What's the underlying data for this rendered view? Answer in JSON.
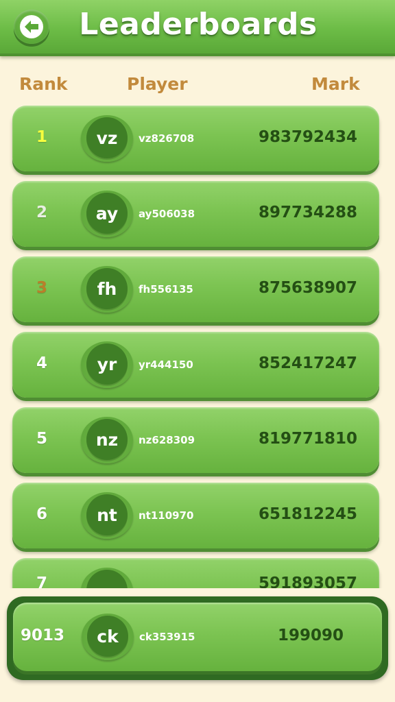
{
  "header": {
    "title": "Leaderboards",
    "back_icon": "back-arrow-icon"
  },
  "columns": {
    "rank": "Rank",
    "player": "Player",
    "mark": "Mark"
  },
  "colors": {
    "header_green": "#6cbc46",
    "row_green": "#7cc452",
    "background": "#fcf4dc",
    "column_header": "#c28a3c",
    "score_text": "#244f14",
    "rank_gold": "#f6ff3e",
    "rank_silver": "#e8efe2",
    "rank_bronze": "#b97f2a"
  },
  "rows": [
    {
      "rank": "1",
      "initials": "vz",
      "name": "vz826708",
      "mark": "983792434",
      "medal": "gold"
    },
    {
      "rank": "2",
      "initials": "ay",
      "name": "ay506038",
      "mark": "897734288",
      "medal": "silver"
    },
    {
      "rank": "3",
      "initials": "fh",
      "name": "fh556135",
      "mark": "875638907",
      "medal": "bronze"
    },
    {
      "rank": "4",
      "initials": "yr",
      "name": "yr444150",
      "mark": "852417247",
      "medal": ""
    },
    {
      "rank": "5",
      "initials": "nz",
      "name": "nz628309",
      "mark": "819771810",
      "medal": ""
    },
    {
      "rank": "6",
      "initials": "nt",
      "name": "nt110970",
      "mark": "651812245",
      "medal": ""
    },
    {
      "rank": "7",
      "initials": "",
      "name": "",
      "mark": "591893057",
      "medal": ""
    }
  ],
  "current_player": {
    "rank": "9013",
    "initials": "ck",
    "name": "ck353915",
    "mark": "199090"
  }
}
